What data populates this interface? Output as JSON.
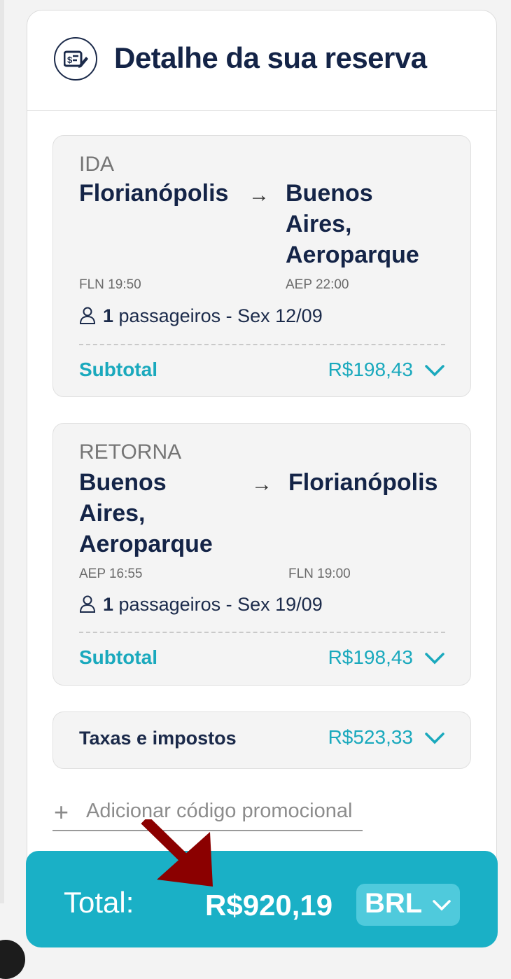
{
  "header": {
    "title": "Detalhe da sua reserva",
    "icon": "receipt-edit-icon"
  },
  "outbound": {
    "label": "IDA",
    "origin_city": "Florianópolis",
    "destination_city_lines": [
      "Buenos",
      "Aires,",
      "Aeroparque"
    ],
    "origin_code_time": "FLN 19:50",
    "destination_code_time": "AEP 22:00",
    "passenger_count": "1",
    "passenger_text": " passageiros - Sex 12/09",
    "subtotal_label": "Subtotal",
    "subtotal_value": "R$198,43"
  },
  "return": {
    "label": "RETORNA",
    "origin_city_lines": [
      "Buenos",
      "Aires,",
      "Aeroparque"
    ],
    "destination_city": "Florianópolis",
    "origin_code_time": "AEP 16:55",
    "destination_code_time": "FLN 19:00",
    "passenger_count": "1",
    "passenger_text": " passageiros - Sex 19/09",
    "subtotal_label": "Subtotal",
    "subtotal_value": "R$198,43"
  },
  "taxes": {
    "label": "Taxas e impostos",
    "value": "R$523,33"
  },
  "promo": {
    "label": "Adicionar código promocional"
  },
  "total": {
    "label": "Total:",
    "value": "R$920,19",
    "currency": "BRL"
  },
  "colors": {
    "accent": "#1ab0c6",
    "title": "#142447",
    "pointer": "#8b0000"
  }
}
